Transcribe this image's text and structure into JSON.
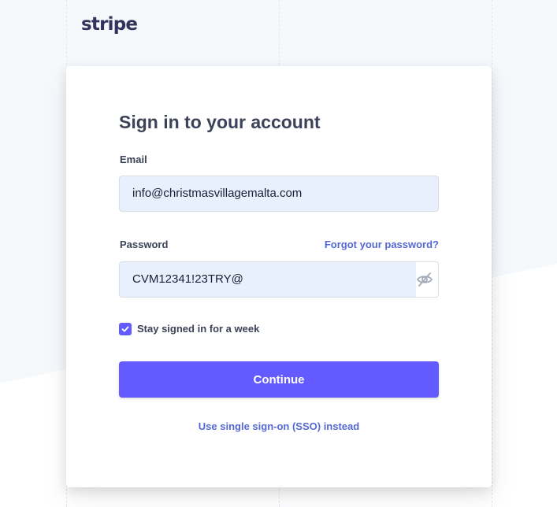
{
  "brand": {
    "logo_text": "stripe"
  },
  "signin": {
    "title": "Sign in to your account",
    "email_label": "Email",
    "email_value": "info@christmasvillagemalta.com",
    "password_label": "Password",
    "forgot_link": "Forgot your password?",
    "password_value": "CVM12341!23TRY@",
    "password_toggle_icon": "eye-slash-icon",
    "remember_label": "Stay signed in for a week",
    "remember_checked": true,
    "continue_label": "Continue",
    "sso_link": "Use single sign-on (SSO) instead"
  },
  "colors": {
    "accent": "#635bff",
    "link": "#5469d4",
    "text": "#3c4257",
    "autofill_bg": "#e8f0fe",
    "page_bg": "#f6f9fc"
  }
}
